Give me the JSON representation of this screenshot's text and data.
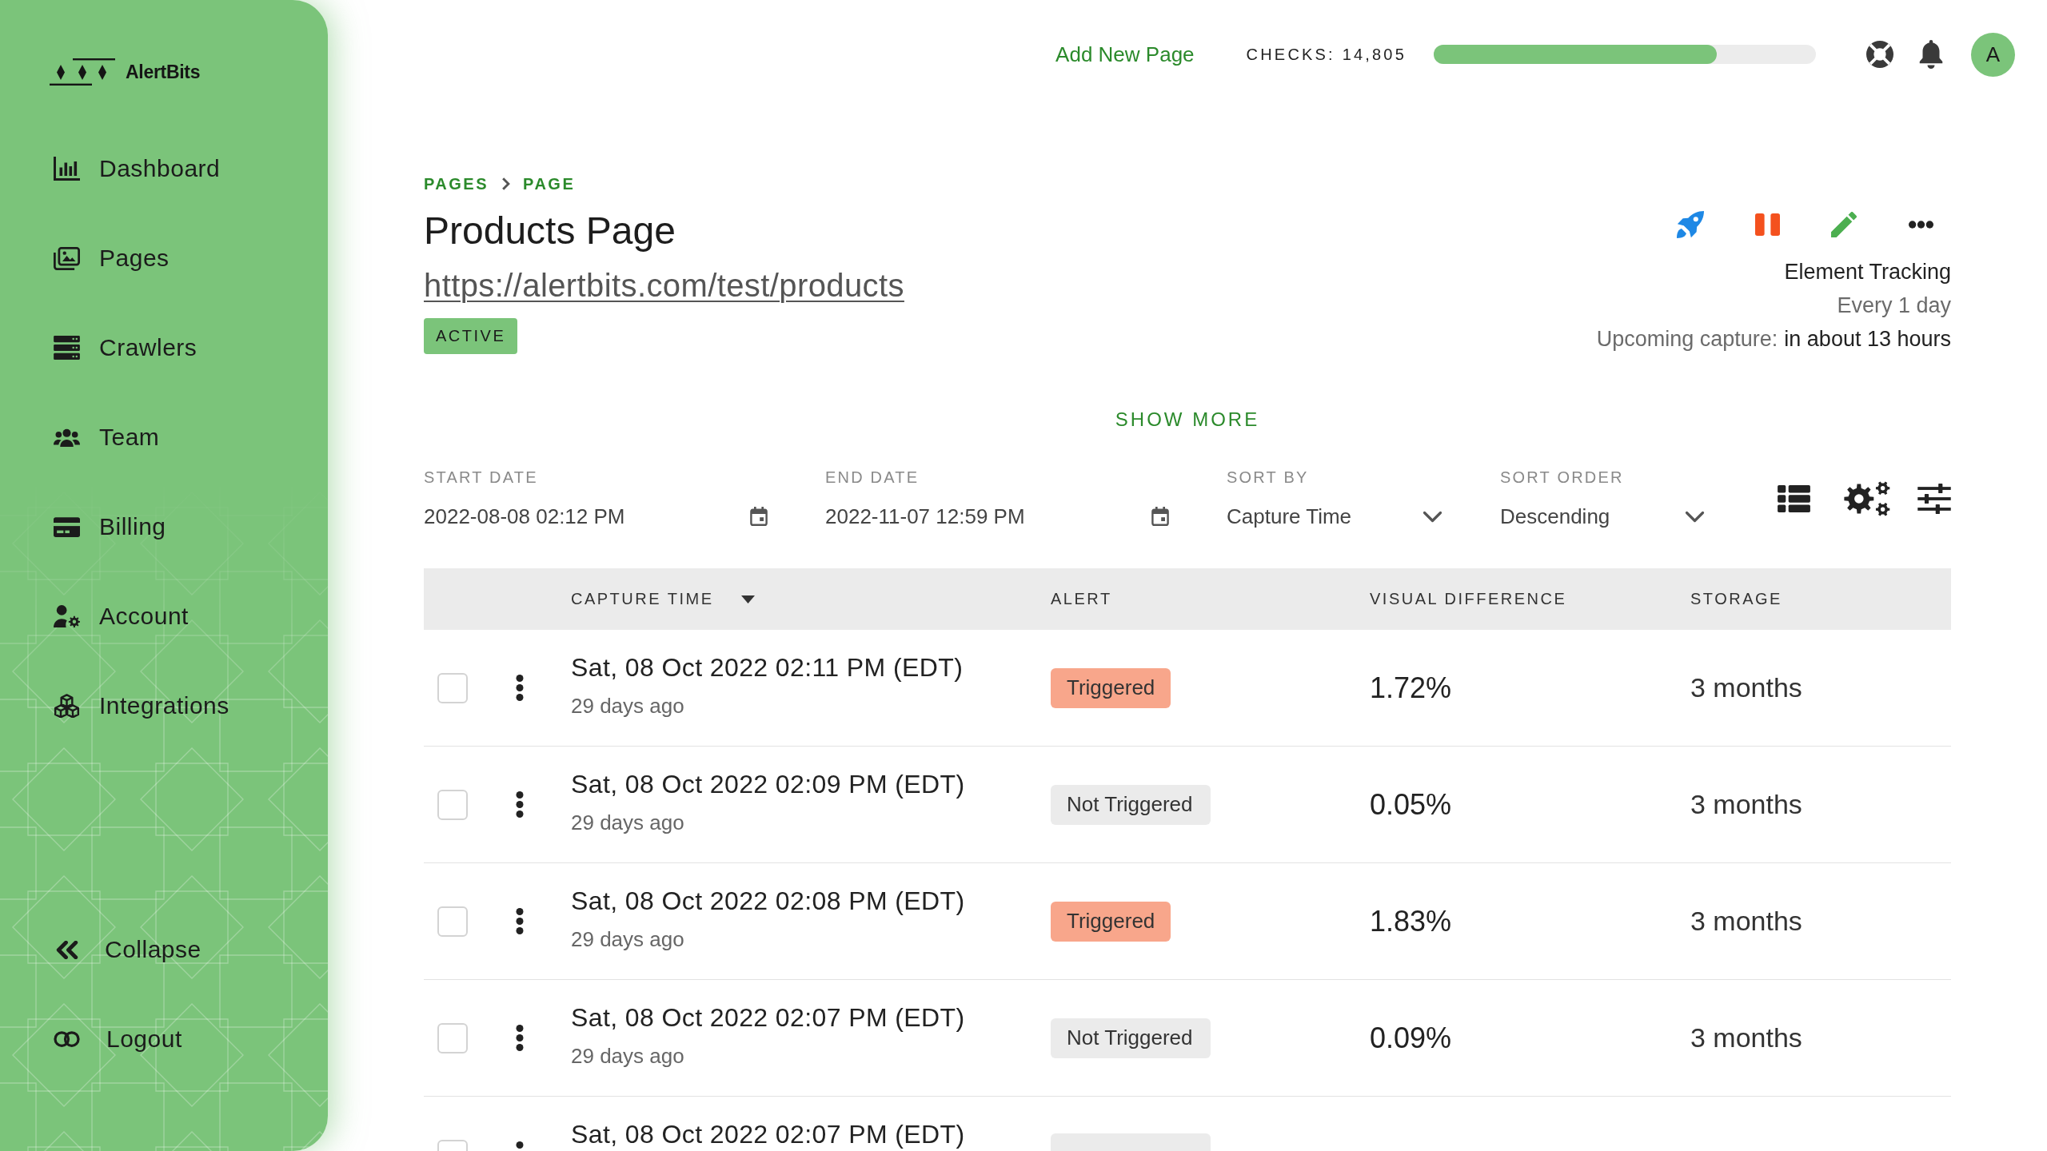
{
  "sidebar": {
    "logo_text": "AlertBits",
    "items": [
      {
        "label": "Dashboard"
      },
      {
        "label": "Pages"
      },
      {
        "label": "Crawlers"
      },
      {
        "label": "Team"
      },
      {
        "label": "Billing"
      },
      {
        "label": "Account"
      },
      {
        "label": "Integrations"
      }
    ],
    "footer_items": [
      {
        "label": "Collapse"
      },
      {
        "label": "Logout"
      }
    ]
  },
  "topbar": {
    "add_page_link": "Add New Page",
    "checks_label": "CHECKS: 14,805",
    "checks_meter": {
      "level": 0.74
    },
    "avatar_initial": "A"
  },
  "page": {
    "breadcrumb": [
      "PAGES",
      "PAGE"
    ],
    "title": "Products Page",
    "url": "https://alertbits.com/test/products",
    "status": "ACTIVE",
    "tracking_type": "Element Tracking",
    "frequency": "Every 1 day",
    "upcoming_label": "Upcoming capture:",
    "upcoming_value": "in about 13 hours",
    "show_more": "SHOW MORE"
  },
  "filters": [
    {
      "label": "START DATE",
      "value": "2022-08-08 02:12 PM",
      "kind": "date"
    },
    {
      "label": "END DATE",
      "value": "2022-11-07 12:59 PM",
      "kind": "date"
    },
    {
      "label": "SORT BY",
      "value": "Capture Time",
      "kind": "select"
    },
    {
      "label": "SORT ORDER",
      "value": "Descending",
      "kind": "select"
    }
  ],
  "table": {
    "columns": [
      {
        "label": "CAPTURE TIME",
        "sorted": true
      },
      {
        "label": "ALERT",
        "sorted": false
      },
      {
        "label": "VISUAL DIFFERENCE",
        "sorted": false
      },
      {
        "label": "STORAGE",
        "sorted": false
      }
    ],
    "rows": [
      {
        "checked": false,
        "capture_time": "Sat, 08 Oct 2022 02:11 PM (EDT)",
        "age": "29 days ago",
        "triggered": true,
        "alert": "Triggered",
        "visual_difference": "1.72%",
        "storage": "3 months"
      },
      {
        "checked": false,
        "capture_time": "Sat, 08 Oct 2022 02:09 PM (EDT)",
        "age": "29 days ago",
        "triggered": false,
        "alert": "Not Triggered",
        "visual_difference": "0.05%",
        "storage": "3 months"
      },
      {
        "checked": false,
        "capture_time": "Sat, 08 Oct 2022 02:08 PM (EDT)",
        "age": "29 days ago",
        "triggered": true,
        "alert": "Triggered",
        "visual_difference": "1.83%",
        "storage": "3 months"
      },
      {
        "checked": false,
        "capture_time": "Sat, 08 Oct 2022 02:07 PM (EDT)",
        "age": "29 days ago",
        "triggered": false,
        "alert": "Not Triggered",
        "visual_difference": "0.09%",
        "storage": "3 months"
      },
      {
        "checked": false,
        "capture_time": "Sat, 08 Oct 2022 02:07 PM (EDT)",
        "triggered": false
      }
    ]
  }
}
